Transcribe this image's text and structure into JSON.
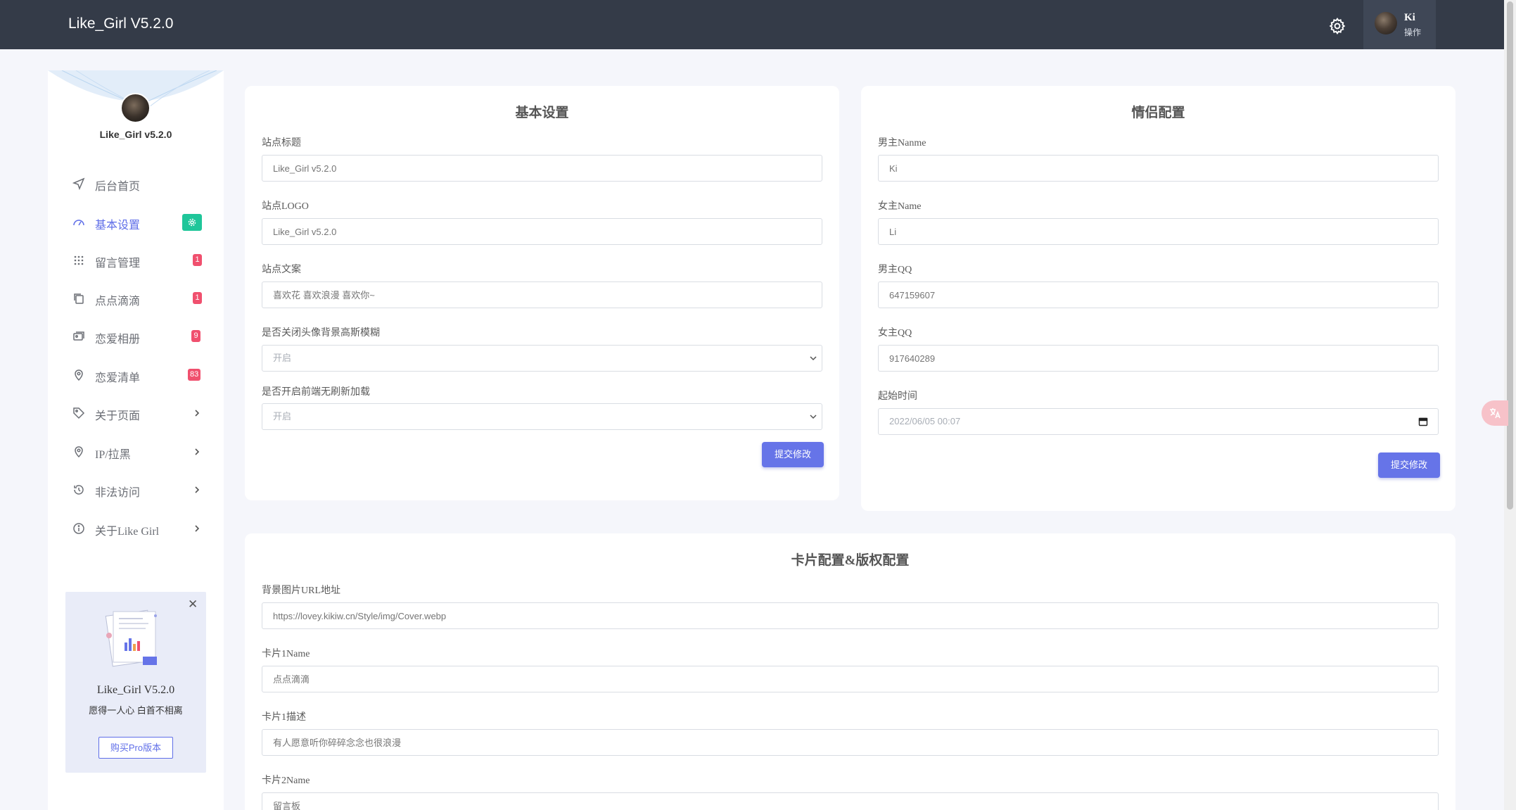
{
  "topbar": {
    "brand": "Like_Girl V5.2.0",
    "user_name": "Ki",
    "user_sub": "操作"
  },
  "sidebar": {
    "site_name": "Like_Girl v5.2.0",
    "items": [
      {
        "label": "后台首页",
        "icon": "send-icon"
      },
      {
        "label": "基本设置",
        "icon": "gauge-icon",
        "active": true,
        "badge": ""
      },
      {
        "label": "留言管理",
        "icon": "grid-icon",
        "badge": "1"
      },
      {
        "label": "点点滴滴",
        "icon": "copy-icon",
        "badge": "1"
      },
      {
        "label": "恋爱相册",
        "icon": "photos-icon",
        "badge": "9"
      },
      {
        "label": "恋爱清单",
        "icon": "pin-icon",
        "badge": "83"
      },
      {
        "label": "关于页面",
        "icon": "tag-icon",
        "has_submenu": true
      },
      {
        "label": "IP/拉黑",
        "icon": "location-icon",
        "has_submenu": true
      },
      {
        "label": "非法访问",
        "icon": "history-icon",
        "has_submenu": true
      },
      {
        "label": "关于Like Girl",
        "icon": "info-icon",
        "has_submenu": true
      }
    ],
    "promo": {
      "title": "Like_Girl V5.2.0",
      "subtitle": "愿得一人心 白首不相离",
      "button": "购买Pro版本"
    }
  },
  "basic_settings": {
    "title": "基本设置",
    "site_title_label": "站点标题",
    "site_title_placeholder": "Like_Girl v5.2.0",
    "site_logo_label": "站点LOGO",
    "site_logo_placeholder": "Like_Girl v5.2.0",
    "site_copy_label": "站点文案",
    "site_copy_placeholder": "喜欢花 喜欢浪漫 喜欢你~",
    "blur_label": "是否关闭头像背景高斯模糊",
    "blur_value": "开启",
    "pjax_label": "是否开启前端无刷新加载",
    "pjax_value": "开启",
    "submit": "提交修改"
  },
  "couple_settings": {
    "title": "情侣配置",
    "boy_name_label": "男主Nanme",
    "boy_name_placeholder": "Ki",
    "girl_name_label": "女主Name",
    "girl_name_placeholder": "Li",
    "boy_qq_label": "男主QQ",
    "boy_qq_placeholder": "647159607",
    "girl_qq_label": "女主QQ",
    "girl_qq_placeholder": "917640289",
    "start_time_label": "起始时间",
    "start_time_value": "2022/06/05 00:07",
    "submit": "提交修改"
  },
  "card_settings": {
    "title": "卡片配置&版权配置",
    "bg_url_label": "背景图片URL地址",
    "bg_url_placeholder": "https://lovey.kikiw.cn/Style/img/Cover.webp",
    "card1_name_label": "卡片1Name",
    "card1_name_placeholder": "点点滴滴",
    "card1_desc_label": "卡片1描述",
    "card1_desc_placeholder": "有人愿意听你碎碎念念也很浪漫",
    "card2_name_label": "卡片2Name",
    "card2_name_placeholder": "留言板"
  },
  "colors": {
    "topbar": "#343b48",
    "accent": "#6674e8",
    "badge_red": "#f0506e",
    "badge_green": "#1fc69a"
  }
}
